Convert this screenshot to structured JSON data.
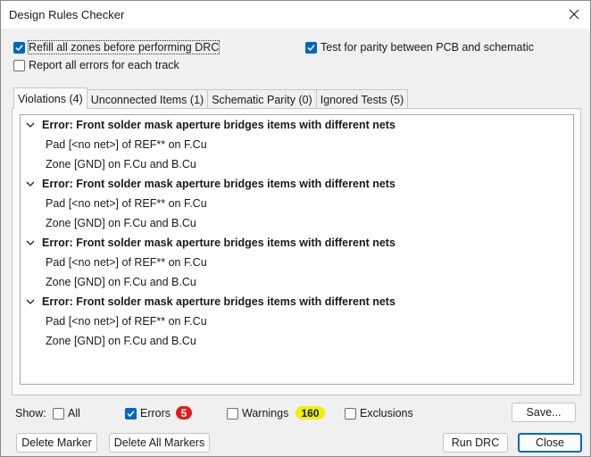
{
  "window": {
    "title": "Design Rules Checker"
  },
  "options": {
    "refill_zones": {
      "label": "Refill all zones before performing DRC",
      "checked": true
    },
    "report_all_errors": {
      "label": "Report all errors for each track",
      "checked": false
    },
    "test_parity": {
      "label": "Test for parity between PCB and schematic",
      "checked": true
    }
  },
  "tabs": [
    {
      "label": "Violations (4)",
      "active": true
    },
    {
      "label": "Unconnected Items (1)",
      "active": false
    },
    {
      "label": "Schematic Parity (0)",
      "active": false
    },
    {
      "label": "Ignored Tests (5)",
      "active": false
    }
  ],
  "violations": [
    {
      "title": "Error: Front solder mask aperture bridges items with different nets",
      "items": [
        "Pad [<no net>] of REF** on F.Cu",
        "Zone [GND] on F.Cu and B.Cu"
      ]
    },
    {
      "title": "Error: Front solder mask aperture bridges items with different nets",
      "items": [
        "Pad [<no net>] of REF** on F.Cu",
        "Zone [GND] on F.Cu and B.Cu"
      ]
    },
    {
      "title": "Error: Front solder mask aperture bridges items with different nets",
      "items": [
        "Pad [<no net>] of REF** on F.Cu",
        "Zone [GND] on F.Cu and B.Cu"
      ]
    },
    {
      "title": "Error: Front solder mask aperture bridges items with different nets",
      "items": [
        "Pad [<no net>] of REF** on F.Cu",
        "Zone [GND] on F.Cu and B.Cu"
      ]
    }
  ],
  "show": {
    "label": "Show:",
    "all": {
      "label": "All",
      "checked": false
    },
    "errors": {
      "label": "Errors",
      "checked": true,
      "count": "5",
      "badge_color": "#e01b1b"
    },
    "warnings": {
      "label": "Warnings",
      "checked": false,
      "count": "160",
      "badge_color": "#f0f000"
    },
    "exclusions": {
      "label": "Exclusions",
      "checked": false
    }
  },
  "buttons": {
    "save": "Save...",
    "delete_marker": "Delete Marker",
    "delete_all_markers": "Delete All Markers",
    "run_drc": "Run DRC",
    "close": "Close"
  },
  "icons": {
    "close": "close-icon",
    "check": "checkmark-icon",
    "expand": "chevron-down-icon"
  }
}
